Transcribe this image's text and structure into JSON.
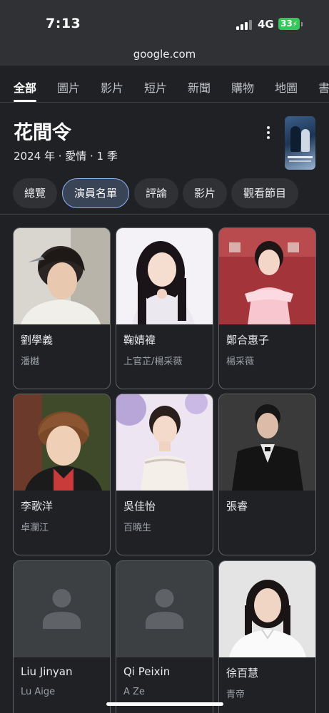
{
  "status": {
    "time": "7:13",
    "network": "4G",
    "battery": "33"
  },
  "browser": {
    "url": "google.com"
  },
  "search_tabs": [
    "全部",
    "圖片",
    "影片",
    "短片",
    "新聞",
    "購物",
    "地圖",
    "書"
  ],
  "entity": {
    "title": "花間令",
    "subtitle": "2024 年 · 愛情 · 1 季"
  },
  "chips": [
    "總覽",
    "演員名單",
    "評論",
    "影片",
    "觀看節目"
  ],
  "cast": [
    {
      "name": "劉學義",
      "role": "潘樾"
    },
    {
      "name": "鞠婧禕",
      "role": "上官芷/楊采薇"
    },
    {
      "name": "鄭合惠子",
      "role": "楊采薇"
    },
    {
      "name": "李歌洋",
      "role": "卓瀾江"
    },
    {
      "name": "吳佳怡",
      "role": "百曉生"
    },
    {
      "name": "張睿",
      "role": ""
    },
    {
      "name": "Liu Jinyan",
      "role": "Lu Aige"
    },
    {
      "name": "Qi Peixin",
      "role": "A Ze"
    },
    {
      "name": "徐百慧",
      "role": "青帝"
    }
  ]
}
